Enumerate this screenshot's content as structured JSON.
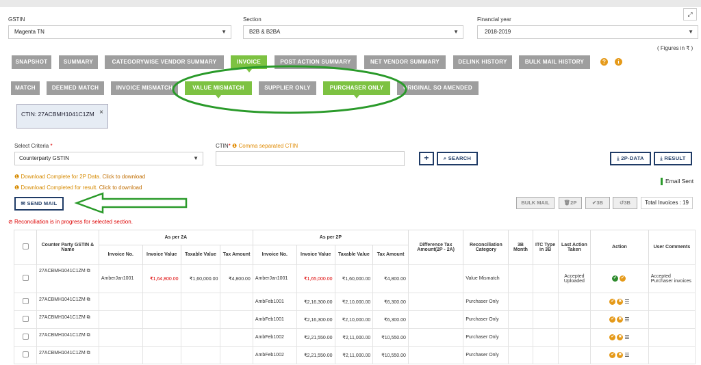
{
  "filters": {
    "gstin_label": "GSTIN",
    "gstin_value": "Magenta TN",
    "section_label": "Section",
    "section_value": "B2B & B2BA",
    "fy_label": "Financial year",
    "fy_value": "2018-2019",
    "figures_note": "( Figures in ₹ )"
  },
  "tabs_row1": [
    "SNAPSHOT",
    "SUMMARY",
    "CATEGORYWISE VENDOR SUMMARY",
    "INVOICE",
    "POST ACTION SUMMARY",
    "NET VENDOR SUMMARY",
    "DELINK HISTORY",
    "BULK MAIL HISTORY"
  ],
  "tabs_row2": [
    "MATCH",
    "DEEMED MATCH",
    "INVOICE MISMATCH",
    "VALUE MISMATCH",
    "SUPPLIER ONLY",
    "PURCHASER ONLY",
    "ORIGINAL SO AMENDED"
  ],
  "help_icons": {
    "question": "?",
    "info": "i"
  },
  "chip": {
    "text": "CTIN: 27ACBMH1041C1ZM",
    "close": "×"
  },
  "criteria": {
    "select_label": "Select Criteria",
    "select_required": "*",
    "select_value": "Counterparty GSTIN",
    "ctin_label": "CTIN",
    "ctin_required": "*",
    "ctin_hint": "Comma separated CTIN"
  },
  "buttons": {
    "add": "+",
    "search": "SEARCH",
    "data_2p": "2P-DATA",
    "result": "RESULT",
    "send_mail": "SEND MAIL",
    "bulk_mail": "BULK MAIL",
    "btn_2p": "2P",
    "btn_3b_check": "3B",
    "btn_3b_undo": "3B"
  },
  "notices": {
    "dl_2p_text": "Download Complete for 2P Data.",
    "dl_2p_link": "Click to download",
    "dl_result_text": "Download Completed for result.",
    "dl_result_link": "Click to download",
    "email_sent": "Email Sent",
    "total_invoices": "Total Invoices : 19",
    "reconciliation": "Reconciliation is in progress for selected section."
  },
  "table": {
    "headers": {
      "gstin": "Counter Party GSTIN & Name",
      "as_per_2a": "As per 2A",
      "as_per_2p": "As per 2P",
      "diff": "Difference Tax Amount(2P - 2A)",
      "category": "Reconciliation Category",
      "month_3b": "3B Month",
      "itc": "ITC Type in 3B",
      "last_action": "Last Action Taken",
      "action": "Action",
      "comments": "User Comments",
      "inv_no": "Invoice No.",
      "inv_val": "Invoice Value",
      "taxable": "Taxable Value",
      "tax_amt": "Tax Amount"
    },
    "rows": [
      {
        "gstin": "27ACBMH1041C1ZM",
        "a_inv": "AmberJan1001",
        "a_val": "₹1,64,800.00",
        "a_tax_val": "₹1,60,000.00",
        "a_tax": "₹4,800.00",
        "p_inv": "AmberJan1001",
        "p_val": "₹1,65,000.00",
        "p_tax_val": "₹1,60,000.00",
        "p_tax": "₹4,800.00",
        "diff": "",
        "category": "Value Mismatch",
        "month": "",
        "itc": "",
        "last": "Accepted Uploaded",
        "comments": "Accepted Purchaser invoices"
      },
      {
        "gstin": "27ACBMH1041C1ZM",
        "a_inv": "",
        "a_val": "",
        "a_tax_val": "",
        "a_tax": "",
        "p_inv": "AmbFeb1001",
        "p_val": "₹2,16,300.00",
        "p_tax_val": "₹2,10,000.00",
        "p_tax": "₹6,300.00",
        "diff": "",
        "category": "Purchaser Only",
        "month": "",
        "itc": "",
        "last": "",
        "comments": ""
      },
      {
        "gstin": "27ACBMH1041C1ZM",
        "a_inv": "",
        "a_val": "",
        "a_tax_val": "",
        "a_tax": "",
        "p_inv": "AmbFeb1001",
        "p_val": "₹2,16,300.00",
        "p_tax_val": "₹2,10,000.00",
        "p_tax": "₹6,300.00",
        "diff": "",
        "category": "Purchaser Only",
        "month": "",
        "itc": "",
        "last": "",
        "comments": ""
      },
      {
        "gstin": "27ACBMH1041C1ZM",
        "a_inv": "",
        "a_val": "",
        "a_tax_val": "",
        "a_tax": "",
        "p_inv": "AmbFeb1002",
        "p_val": "₹2,21,550.00",
        "p_tax_val": "₹2,11,000.00",
        "p_tax": "₹10,550.00",
        "diff": "",
        "category": "Purchaser Only",
        "month": "",
        "itc": "",
        "last": "",
        "comments": ""
      },
      {
        "gstin": "27ACBMH1041C1ZM",
        "a_inv": "",
        "a_val": "",
        "a_tax_val": "",
        "a_tax": "",
        "p_inv": "AmbFeb1002",
        "p_val": "₹2,21,550.00",
        "p_tax_val": "₹2,11,000.00",
        "p_tax": "₹10,550.00",
        "diff": "",
        "category": "Purchaser Only",
        "month": "",
        "itc": "",
        "last": "",
        "comments": ""
      }
    ]
  },
  "colors": {
    "green_tab": "#7dc242",
    "grey_tab": "#9e9e9e",
    "annotation": "#2a9a2a",
    "navy": "#1f3b66"
  }
}
